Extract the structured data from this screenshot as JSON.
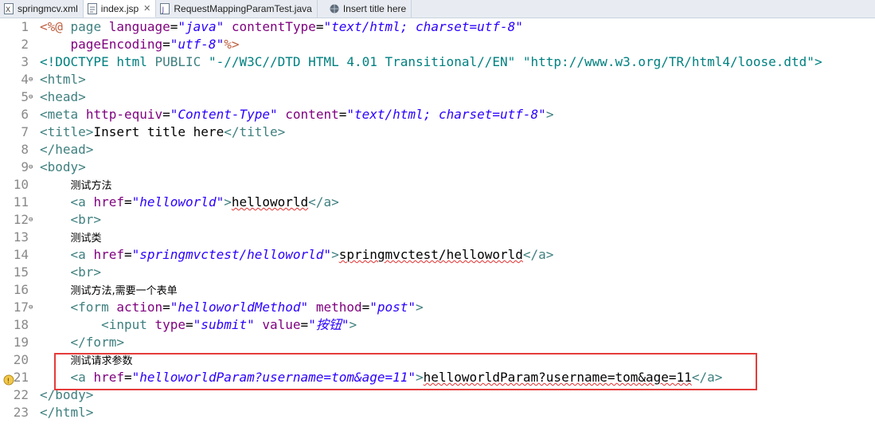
{
  "tabs": [
    {
      "label": "springmcv.xml",
      "icon": "xml-file-icon",
      "active": false
    },
    {
      "label": "index.jsp",
      "icon": "jsp-file-icon",
      "active": true,
      "close": "✕"
    },
    {
      "label": "RequestMappingParamTest.java",
      "icon": "java-file-icon",
      "active": false
    },
    {
      "label": "Insert title here",
      "icon": "browser-globe-icon",
      "active": false
    }
  ],
  "lines": [
    {
      "n": "1",
      "fold": ""
    },
    {
      "n": "2",
      "fold": ""
    },
    {
      "n": "3",
      "fold": ""
    },
    {
      "n": "4",
      "fold": "⊖"
    },
    {
      "n": "5",
      "fold": "⊖"
    },
    {
      "n": "6",
      "fold": ""
    },
    {
      "n": "7",
      "fold": ""
    },
    {
      "n": "8",
      "fold": ""
    },
    {
      "n": "9",
      "fold": "⊖"
    },
    {
      "n": "10",
      "fold": ""
    },
    {
      "n": "11",
      "fold": ""
    },
    {
      "n": "12",
      "fold": "⊖"
    },
    {
      "n": "13",
      "fold": ""
    },
    {
      "n": "14",
      "fold": ""
    },
    {
      "n": "15",
      "fold": ""
    },
    {
      "n": "16",
      "fold": ""
    },
    {
      "n": "17",
      "fold": "⊖"
    },
    {
      "n": "18",
      "fold": ""
    },
    {
      "n": "19",
      "fold": ""
    },
    {
      "n": "20",
      "fold": ""
    },
    {
      "n": "21",
      "fold": ""
    },
    {
      "n": "22",
      "fold": ""
    },
    {
      "n": "23",
      "fold": ""
    }
  ],
  "code": {
    "l1": [
      "<%@",
      " page ",
      "language",
      "=",
      "\"java\"",
      " ",
      "contentType",
      "=",
      "\"text/html; charset=utf-8\""
    ],
    "l2": [
      "    ",
      "pageEncoding",
      "=",
      "\"utf-8\"",
      "%>"
    ],
    "l3": [
      "<!DOCTYPE html ",
      "PUBLIC ",
      "\"-//W3C//DTD HTML 4.01 Transitional//EN\"",
      " ",
      "\"http://www.w3.org/TR/html4/loose.dtd\"",
      ">"
    ],
    "l4": [
      "<html>"
    ],
    "l5": [
      "<head>"
    ],
    "l6": [
      "<meta",
      " ",
      "http-equiv",
      "=",
      "\"Content-Type\"",
      " ",
      "content",
      "=",
      "\"text/html; charset=utf-8\"",
      ">"
    ],
    "l7": [
      "<title>",
      "Insert title here",
      "</title>"
    ],
    "l8": [
      "</head>"
    ],
    "l9": [
      "<body>"
    ],
    "l10": [
      "    ",
      "测试方法"
    ],
    "l11": [
      "    ",
      "<a",
      " ",
      "href",
      "=",
      "\"helloworld\"",
      ">",
      "helloworld",
      "</a>"
    ],
    "l12": [
      "    ",
      "<br>"
    ],
    "l13": [
      "    ",
      "测试类"
    ],
    "l14": [
      "    ",
      "<a",
      " ",
      "href",
      "=",
      "\"springmvctest/helloworld\"",
      ">",
      "springmvctest/helloworld",
      "</a>"
    ],
    "l15": [
      "    ",
      "<br>"
    ],
    "l16": [
      "    ",
      "测试方法,需要一个表单"
    ],
    "l17": [
      "    ",
      "<form",
      " ",
      "action",
      "=",
      "\"helloworldMethod\"",
      " ",
      "method",
      "=",
      "\"post\"",
      ">"
    ],
    "l18": [
      "        ",
      "<input",
      " ",
      "type",
      "=",
      "\"submit\"",
      " ",
      "value",
      "=",
      "\"按钮\"",
      ">"
    ],
    "l19": [
      "    ",
      "</form>"
    ],
    "l20": [
      "    ",
      "测试请求参数"
    ],
    "l21": [
      "    ",
      "<a",
      " ",
      "href",
      "=",
      "\"helloworldParam?username=tom&age=11\"",
      ">",
      "helloworldParam?username=tom&age=11",
      "</a>"
    ],
    "l22": [
      "</body>"
    ],
    "l23": [
      "</html>"
    ]
  },
  "colors": {
    "tag": "#3f7f7f",
    "attr": "#7f007f",
    "value": "#2a00ff",
    "highlight_box": "#e53b3b"
  }
}
